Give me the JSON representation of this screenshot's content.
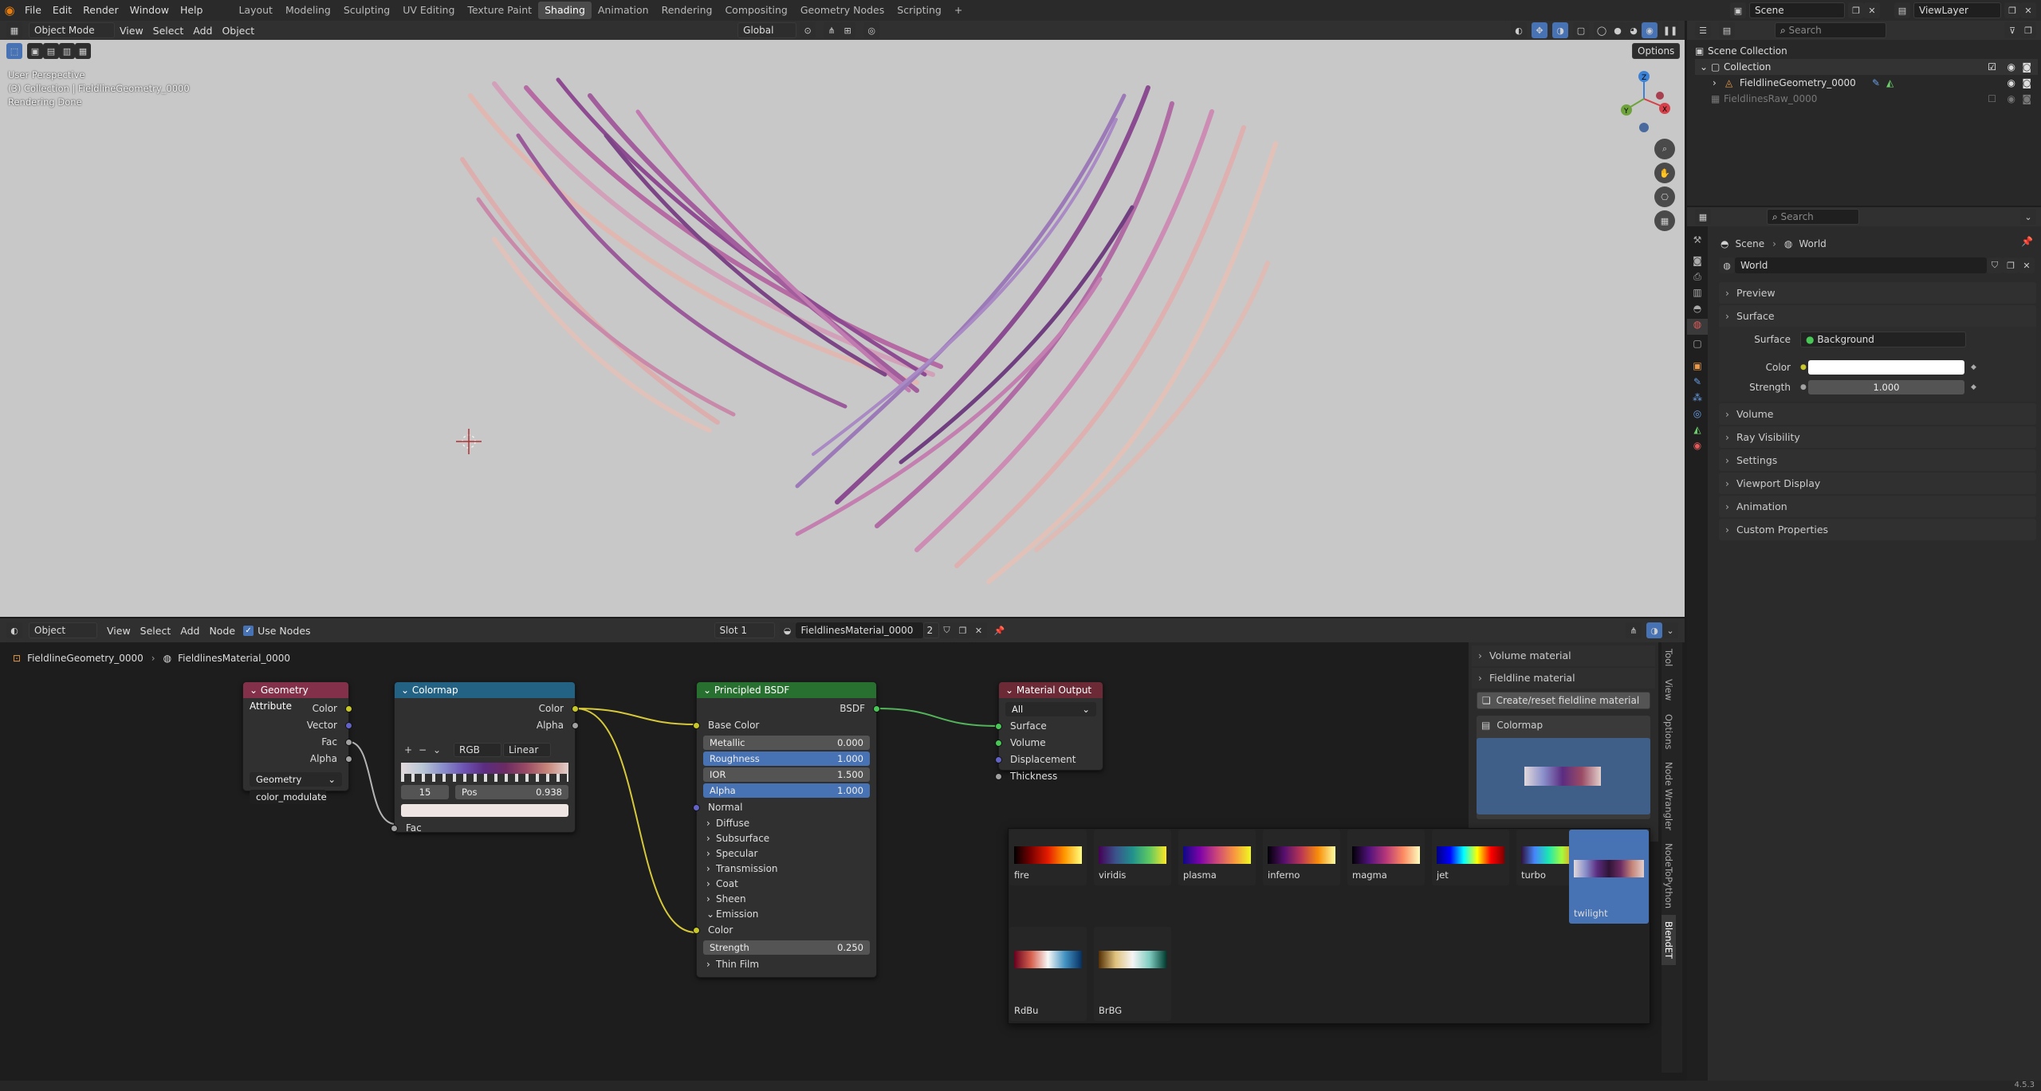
{
  "top_menu": [
    "File",
    "Edit",
    "Render",
    "Window",
    "Help"
  ],
  "workspace_tabs": [
    "Layout",
    "Modeling",
    "Sculpting",
    "UV Editing",
    "Texture Paint",
    "Shading",
    "Animation",
    "Rendering",
    "Compositing",
    "Geometry Nodes",
    "Scripting"
  ],
  "active_workspace": "Shading",
  "scene_name": "Scene",
  "viewlayer_name": "ViewLayer",
  "viewport": {
    "mode": "Object Mode",
    "menus": [
      "View",
      "Select",
      "Add",
      "Object"
    ],
    "transform_orientation": "Global",
    "options_label": "Options",
    "overlay_line1": "User Perspective",
    "overlay_line2": "(3) Collection | FieldlineGeometry_0000",
    "overlay_line3": "Rendering Done"
  },
  "outliner": {
    "search_placeholder": "Search",
    "root": "Scene Collection",
    "collection": "Collection",
    "items": [
      "FieldlineGeometry_0000",
      "FieldlinesRaw_0000"
    ]
  },
  "properties": {
    "search_placeholder": "Search",
    "breadcrumb_scene": "Scene",
    "breadcrumb_world": "World",
    "world_name": "World",
    "panel_preview": "Preview",
    "panel_surface": "Surface",
    "surface_label": "Surface",
    "surface_value": "Background",
    "color_label": "Color",
    "strength_label": "Strength",
    "strength_value": "1.000",
    "collapsed_panels": [
      "Volume",
      "Ray Visibility",
      "Settings",
      "Viewport Display",
      "Animation",
      "Custom Properties"
    ]
  },
  "node_editor": {
    "type": "Object",
    "menus": [
      "View",
      "Select",
      "Add",
      "Node"
    ],
    "use_nodes_label": "Use Nodes",
    "slot": "Slot 1",
    "material": "FieldlinesMaterial_0000",
    "users": "2",
    "breadcrumb_object": "FieldlineGeometry_0000",
    "breadcrumb_material": "FieldlinesMaterial_0000"
  },
  "nodes": {
    "geom_attr": {
      "title": "Geometry Attribute",
      "outputs": [
        "Color",
        "Vector",
        "Fac",
        "Alpha"
      ],
      "type_value": "Geometry",
      "name_value": "color_modulate"
    },
    "colormap": {
      "title": "Colormap",
      "outputs": [
        "Color",
        "Alpha"
      ],
      "color_mode": "RGB",
      "interpolation": "Linear",
      "index": "15",
      "pos_label": "Pos",
      "pos_value": "0.938",
      "input": "Fac"
    },
    "bsdf": {
      "title": "Principled BSDF",
      "output": "BSDF",
      "base_color": "Base Color",
      "fields": [
        {
          "label": "Metallic",
          "value": "0.000",
          "blue": false
        },
        {
          "label": "Roughness",
          "value": "1.000",
          "blue": true
        },
        {
          "label": "IOR",
          "value": "1.500",
          "blue": false
        },
        {
          "label": "Alpha",
          "value": "1.000",
          "blue": true
        }
      ],
      "normal": "Normal",
      "sections": [
        "Diffuse",
        "Subsurface",
        "Specular",
        "Transmission",
        "Coat",
        "Sheen",
        "Emission"
      ],
      "emission_color": "Color",
      "emission_strength_label": "Strength",
      "emission_strength_value": "0.250",
      "thin_film": "Thin Film"
    },
    "output": {
      "title": "Material Output",
      "target": "All",
      "inputs": [
        "Surface",
        "Volume",
        "Displacement",
        "Thickness"
      ]
    }
  },
  "sidebar_panel": {
    "volume_material": "Volume material",
    "fieldline_material": "Fieldline material",
    "create_button": "Create/reset fieldline material",
    "colormap_label": "Colormap",
    "tabs": [
      "Tool",
      "View",
      "Options",
      "Node Wrangler",
      "NodeToPython",
      "BlendET"
    ]
  },
  "colormaps": [
    "fire",
    "viridis",
    "plasma",
    "inferno",
    "magma",
    "jet",
    "turbo",
    "twilight",
    "RdBu",
    "BrBG"
  ],
  "selected_colormap": "twilight",
  "version": "4.5.3",
  "colors": {
    "accent": "#4772b3",
    "node_geom": "#83314a",
    "node_cmap": "#246283",
    "node_bsdf": "#27702f",
    "node_out": "#6b2a36"
  }
}
